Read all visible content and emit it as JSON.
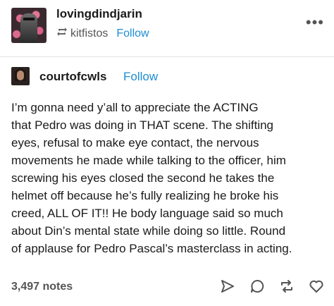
{
  "reblog_header": {
    "username": "lovingdindjarin",
    "reblogged_from": "kitfistos",
    "follow_label": "Follow"
  },
  "post": {
    "author": "courtofcwls",
    "follow_label": "Follow",
    "body_lines": [
      "I’m gonna need y’all to appreciate the ACTING",
      "that Pedro was doing in THAT scene. The shifting",
      "eyes, refusal to make eye contact, the nervous",
      "movements he made while talking to the officer, him",
      "screwing his eyes closed the second he takes the",
      "helmet off because he’s fully realizing he broke his",
      "creed, ALL OF IT!! He body language said so much",
      "about Din’s mental state while doing so little. Round",
      "of applause for Pedro Pascal’s masterclass in acting."
    ]
  },
  "footer": {
    "notes": "3,497 notes",
    "icons": [
      "share-icon",
      "reply-icon",
      "reblog-icon",
      "like-icon"
    ]
  },
  "colors": {
    "accent": "#1d8dd3",
    "text": "#1a1a1a",
    "muted": "#555555"
  }
}
